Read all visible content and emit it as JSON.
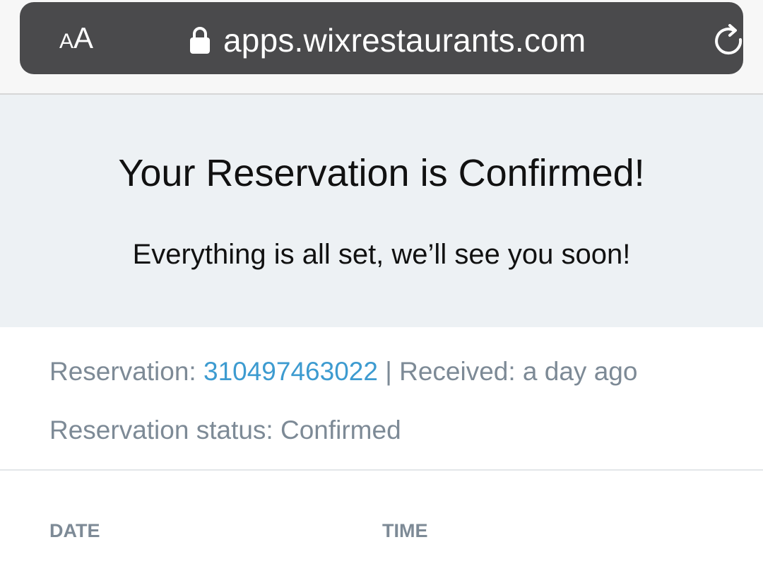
{
  "browser": {
    "text_size_small": "A",
    "text_size_large": "A",
    "url": "apps.wixrestaurants.com",
    "lock_icon": "lock-icon",
    "reload_icon": "reload-icon"
  },
  "banner": {
    "title": "Your Reservation is Confirmed!",
    "subtitle": "Everything is all set, we’ll see you soon!"
  },
  "details": {
    "reservation_label": "Reservation: ",
    "reservation_number": "310497463022",
    "separator": " | ",
    "received_label": "Received: ",
    "received_value": "a day ago",
    "status_label": "Reservation status: ",
    "status_value": "Confirmed"
  },
  "columns": {
    "date_label": "DATE",
    "time_label": "TIME"
  },
  "colors": {
    "address_bar": "#4a4a4c",
    "banner_bg": "#edf1f4",
    "muted_text": "#7d8a96",
    "link_blue": "#3d9bd0"
  }
}
